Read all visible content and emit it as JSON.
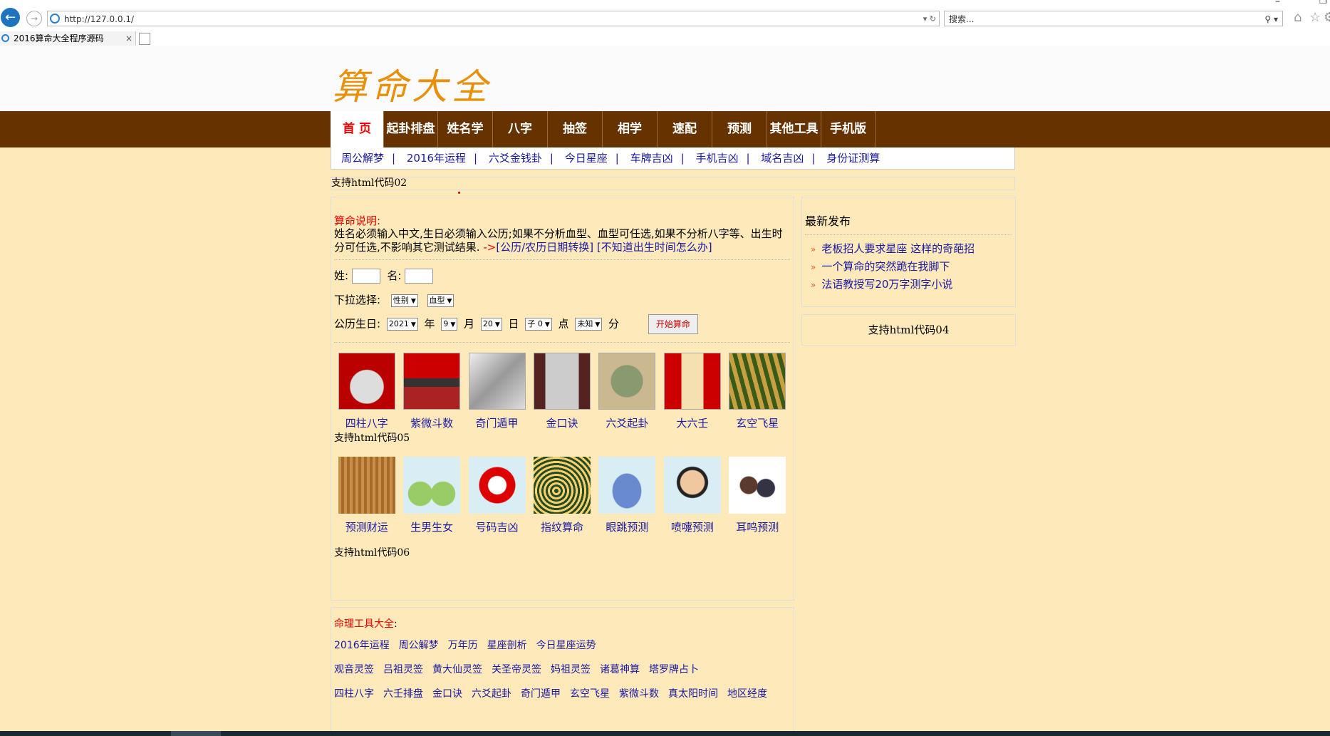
{
  "browser": {
    "url": "http://127.0.0.1/",
    "search_placeholder": "搜索...",
    "tab_title": "2016算命大全程序源码",
    "tab_close": "×"
  },
  "site": {
    "logo_text": "算命大全",
    "nav": [
      "首 页",
      "起卦排盘",
      "姓名学",
      "八字",
      "抽签",
      "相学",
      "速配",
      "预测",
      "其他工具",
      "手机版"
    ],
    "subnav": [
      "周公解梦",
      "2016年运程",
      "六爻金钱卦",
      "今日星座",
      "车牌吉凶",
      "手机吉凶",
      "域名吉凶",
      "身份证测算"
    ],
    "ad02": "支持html代码02"
  },
  "main": {
    "desc_label": "算命说明:",
    "desc_text": "姓名必须输入中文,生日必须输入公历;如果不分析血型、血型可任选,如果不分析八字等、出生时分可任选,不影响其它测试结果.",
    "desc_arrow": "->",
    "desc_link1": "[公历/农历日期转换]",
    "desc_link2": "[不知道出生时间怎么办]",
    "surname_label": "姓:",
    "name_label": "名:",
    "dropdown_label": "下拉选择:",
    "gender_select": "性别",
    "blood_select": "血型",
    "birthday_label": "公历生日:",
    "year_select": "2021",
    "year_unit": "年",
    "month_select": "9",
    "month_unit": "月",
    "day_select": "20",
    "day_unit": "日",
    "hour_select": "子 0",
    "hour_unit": "点",
    "minute_select": "未知",
    "minute_unit": "分",
    "start_button": "开始算命",
    "row1": [
      "四柱八字",
      "紫微斗数",
      "奇门遁甲",
      "金口诀",
      "六爻起卦",
      "大六壬",
      "玄空飞星"
    ],
    "ad05": "支持html代码05",
    "row2": [
      "预测财运",
      "生男生女",
      "号码吉凶",
      "指纹算命",
      "眼跳预测",
      "喷嚏预测",
      "耳鸣预测"
    ],
    "ad06": "支持html代码06"
  },
  "side": {
    "title": "最新发布",
    "items": [
      "老板招人要求星座 这样的奇葩招",
      "一个算命的突然跪在我脚下",
      "法语教授写20万字测字小说"
    ],
    "ad04": "支持html代码04"
  },
  "tools": {
    "title": "命理工具大全",
    "colon": ":",
    "row1": [
      "2016年运程",
      "周公解梦",
      "万年历",
      "星座剖析",
      "今日星座运势"
    ],
    "row2": [
      "观音灵签",
      "吕祖灵签",
      "黄大仙灵签",
      "关圣帝灵签",
      "妈祖灵签",
      "诸葛神算",
      "塔罗牌占卜"
    ],
    "row3": [
      "四柱八字",
      "六壬排盘",
      "金口诀",
      "六爻起卦",
      "奇门遁甲",
      "玄空飞星",
      "紫微斗数",
      "真太阳时间",
      "地区经度"
    ]
  },
  "colors": {
    "page_bg": "#fde9b9",
    "nav_bg": "#663300",
    "link": "#1a1aa6",
    "accent_red": "#e00",
    "logo": "#e8900a"
  }
}
